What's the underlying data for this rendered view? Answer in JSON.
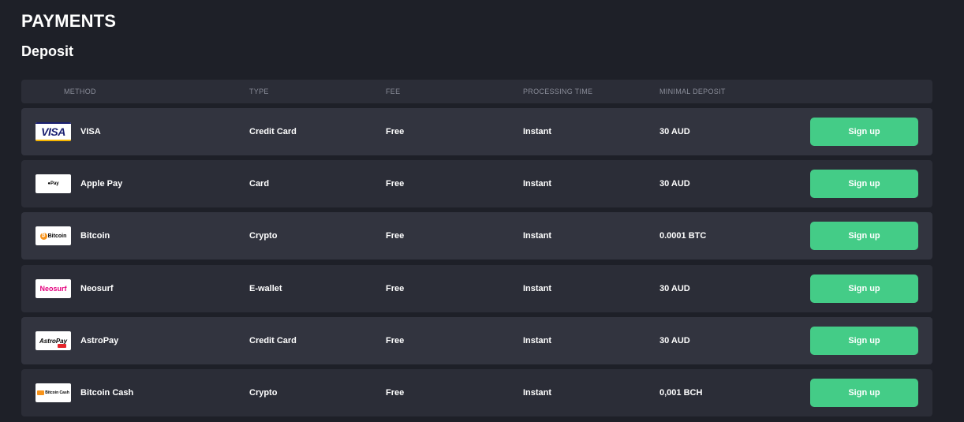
{
  "page": {
    "title": "PAYMENTS",
    "section": "Deposit"
  },
  "columns": {
    "method": "METHOD",
    "type": "TYPE",
    "fee": "FEE",
    "processing": "PROCESSING TIME",
    "minimal": "MINIMAL DEPOSIT"
  },
  "rows": [
    {
      "method": "VISA",
      "type": "Credit Card",
      "fee": "Free",
      "processing": "Instant",
      "minimal": "30 AUD",
      "button": "Sign up",
      "logo_text": "VISA"
    },
    {
      "method": "Apple Pay",
      "type": "Card",
      "fee": "Free",
      "processing": "Instant",
      "minimal": "30 AUD",
      "button": "Sign up",
      "logo_text": "Pay"
    },
    {
      "method": "Bitcoin",
      "type": "Crypto",
      "fee": "Free",
      "processing": "Instant",
      "minimal": "0.0001 BTC",
      "button": "Sign up",
      "logo_text": "Bitcoin"
    },
    {
      "method": "Neosurf",
      "type": "E-wallet",
      "fee": "Free",
      "processing": "Instant",
      "minimal": "30 AUD",
      "button": "Sign up",
      "logo_text": "Neosurf"
    },
    {
      "method": "AstroPay",
      "type": "Credit Card",
      "fee": "Free",
      "processing": "Instant",
      "minimal": "30 AUD",
      "button": "Sign up",
      "logo_text": "AstroPay"
    },
    {
      "method": "Bitcoin Cash",
      "type": "Crypto",
      "fee": "Free",
      "processing": "Instant",
      "minimal": "0,001 BCH",
      "button": "Sign up",
      "logo_text": "Bitcoin Cash"
    }
  ],
  "colors": {
    "background": "#1e2028",
    "row": "#2b2d37",
    "row_alt": "#32343f",
    "button": "#44cc87",
    "header_text": "#8a8d99"
  }
}
